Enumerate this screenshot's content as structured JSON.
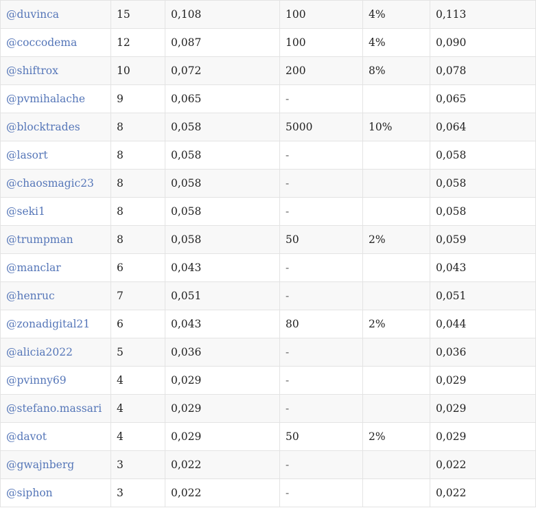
{
  "rows": [
    {
      "user": "@duvinca",
      "votes": "15",
      "value": "0,108",
      "amount": "100",
      "percent": "4%",
      "total": "0,113"
    },
    {
      "user": "@coccodema",
      "votes": "12",
      "value": "0,087",
      "amount": "100",
      "percent": "4%",
      "total": "0,090"
    },
    {
      "user": "@shiftrox",
      "votes": "10",
      "value": "0,072",
      "amount": "200",
      "percent": "8%",
      "total": "0,078"
    },
    {
      "user": "@pvmihalache",
      "votes": "9",
      "value": "0,065",
      "amount": "-",
      "percent": "",
      "total": "0,065"
    },
    {
      "user": "@blocktrades",
      "votes": "8",
      "value": "0,058",
      "amount": "5000",
      "percent": "10%",
      "total": "0,064"
    },
    {
      "user": "@lasort",
      "votes": "8",
      "value": "0,058",
      "amount": "-",
      "percent": "",
      "total": "0,058"
    },
    {
      "user": "@chaosmagic23",
      "votes": "8",
      "value": "0,058",
      "amount": "-",
      "percent": "",
      "total": "0,058"
    },
    {
      "user": "@seki1",
      "votes": "8",
      "value": "0,058",
      "amount": "-",
      "percent": "",
      "total": "0,058"
    },
    {
      "user": "@trumpman",
      "votes": "8",
      "value": "0,058",
      "amount": "50",
      "percent": "2%",
      "total": "0,059"
    },
    {
      "user": "@manclar",
      "votes": "6",
      "value": "0,043",
      "amount": "-",
      "percent": "",
      "total": "0,043"
    },
    {
      "user": "@henruc",
      "votes": "7",
      "value": "0,051",
      "amount": "-",
      "percent": "",
      "total": "0,051"
    },
    {
      "user": "@zonadigital21",
      "votes": "6",
      "value": "0,043",
      "amount": "80",
      "percent": "2%",
      "total": "0,044"
    },
    {
      "user": "@alicia2022",
      "votes": "5",
      "value": "0,036",
      "amount": "-",
      "percent": "",
      "total": "0,036"
    },
    {
      "user": "@pvinny69",
      "votes": "4",
      "value": "0,029",
      "amount": "-",
      "percent": "",
      "total": "0,029"
    },
    {
      "user": "@stefano.massari",
      "votes": "4",
      "value": "0,029",
      "amount": "-",
      "percent": "",
      "total": "0,029"
    },
    {
      "user": "@davot",
      "votes": "4",
      "value": "0,029",
      "amount": "50",
      "percent": "2%",
      "total": "0,029"
    },
    {
      "user": "@gwajnberg",
      "votes": "3",
      "value": "0,022",
      "amount": "-",
      "percent": "",
      "total": "0,022"
    },
    {
      "user": "@siphon",
      "votes": "3",
      "value": "0,022",
      "amount": "-",
      "percent": "",
      "total": "0,022"
    }
  ],
  "colors": {
    "link": "#5576b8",
    "text": "#222222",
    "border": "#e3e3e3",
    "stripe": "#f8f8f8"
  }
}
